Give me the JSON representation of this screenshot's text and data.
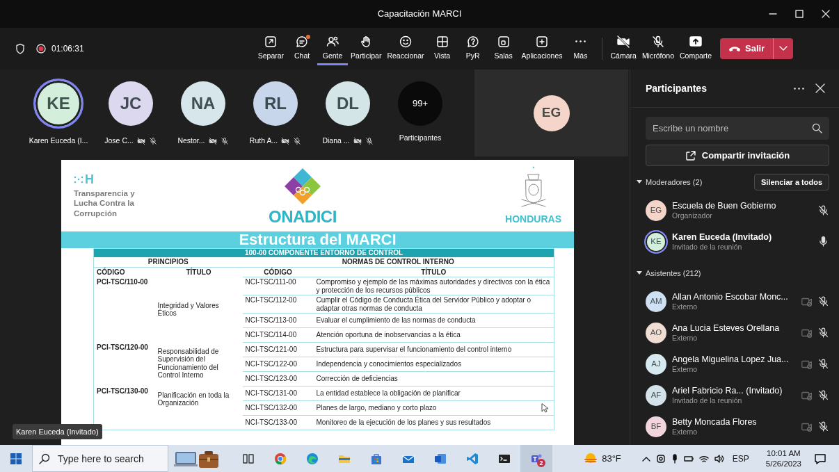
{
  "window": {
    "title": "Capacitación MARCI"
  },
  "toolbar": {
    "recording": true,
    "timer": "01:06:31",
    "buttons": [
      {
        "label": "Separar",
        "selected": false,
        "unread": false
      },
      {
        "label": "Chat",
        "selected": false,
        "unread": true
      },
      {
        "label": "Gente",
        "selected": true,
        "unread": false
      },
      {
        "label": "Participar",
        "selected": false,
        "unread": false
      },
      {
        "label": "Reaccionar",
        "selected": false,
        "unread": false
      },
      {
        "label": "Vista",
        "selected": false,
        "unread": false
      },
      {
        "label": "PyR",
        "selected": false,
        "unread": false
      },
      {
        "label": "Salas",
        "selected": false,
        "unread": false
      },
      {
        "label": "Aplicaciones",
        "selected": false,
        "unread": false
      },
      {
        "label": "Más",
        "selected": false,
        "unread": false
      }
    ],
    "devices": [
      {
        "label": "Cámara"
      },
      {
        "label": "Micrófono"
      },
      {
        "label": "Comparte"
      }
    ],
    "leave": {
      "label": "Salir"
    }
  },
  "video_strip": {
    "tiles": [
      {
        "kind": "person",
        "initials": "KE",
        "name": "Karen Euceda (I...",
        "color": "#d3eedb",
        "speaking": true,
        "muted": false,
        "camera_off": false
      },
      {
        "kind": "person",
        "initials": "JC",
        "name": "Jose C...",
        "color": "#dcd8f0",
        "speaking": false,
        "muted": true,
        "camera_off": true
      },
      {
        "kind": "person",
        "initials": "NA",
        "name": "Nestor...",
        "color": "#d6e6ea",
        "speaking": false,
        "muted": true,
        "camera_off": true
      },
      {
        "kind": "person",
        "initials": "RL",
        "name": "Ruth A...",
        "color": "#c8d6eb",
        "speaking": false,
        "muted": true,
        "camera_off": true
      },
      {
        "kind": "person",
        "initials": "DL",
        "name": "Diana ...",
        "color": "#d4e5e8",
        "speaking": false,
        "muted": true,
        "camera_off": true
      },
      {
        "kind": "overflow",
        "initials": "99+",
        "name": "Participantes",
        "color": "#0a0a0a"
      }
    ],
    "spotlight": {
      "initials": "EG",
      "color": "#f5d4c9"
    }
  },
  "slide": {
    "left_logo": {
      "mark": "H",
      "text": "Transparencia y Lucha Contra la Corrupción"
    },
    "center_logo": "ONADICI",
    "right_logo": "HONDURAS",
    "title": "Estructura del MARCI",
    "component": "100-00 COMPONENTE ENTORNO DE CONTROL",
    "group_headers": [
      "PRINCIPIOS",
      "NORMAS DE CONTROL INTERNO"
    ],
    "columns": [
      "CÓDIGO",
      "TÍTULO",
      "CÓDIGO",
      "TÍTULO"
    ],
    "groups": [
      {
        "code": "PCI-TSC/110-00",
        "title": "Integridad y Valores Éticos",
        "norms": [
          {
            "code": "NCI-TSC/111-00",
            "title": "Compromiso y ejemplo de las máximas autoridades y directivos con la ética y protección de los recursos públicos"
          },
          {
            "code": "NCI-TSC/112-00",
            "title": "Cumplir el Código de Conducta Ética del Servidor Público y adoptar o adaptar otras normas de conducta"
          },
          {
            "code": "NCI-TSC/113-00",
            "title": "Evaluar el cumplimiento de las normas de conducta"
          },
          {
            "code": "NCI-TSC/114-00",
            "title": "Atención oportuna de inobservancias a la ética"
          }
        ]
      },
      {
        "code": "PCI-TSC/120-00",
        "title": "Responsabilidad de Supervisión del Funcionamiento del Control Interno",
        "norms": [
          {
            "code": "NCI-TSC/121-00",
            "title": "Estructura para supervisar el funcionamiento del control interno"
          },
          {
            "code": "NCI-TSC/122-00",
            "title": "Independencia y conocimientos especializados"
          },
          {
            "code": "NCI-TSC/123-00",
            "title": "Corrección de deficiencias"
          }
        ]
      },
      {
        "code": "PCI-TSC/130-00",
        "title": "Planificación en toda la Organización",
        "norms": [
          {
            "code": "NCI-TSC/131-00",
            "title": "La entidad establece la obligación de planificar"
          },
          {
            "code": "NCI-TSC/132-00",
            "title": "Planes de largo, mediano y corto plazo"
          },
          {
            "code": "NCI-TSC/133-00",
            "title": "Monitoreo de la ejecución de los planes y sus resultados"
          }
        ]
      }
    ]
  },
  "name_tag": "Karen Euceda (Invitado)",
  "panel": {
    "title": "Participantes",
    "search": {
      "placeholder": "Escribe un nombre"
    },
    "share_button": "Compartir invitación",
    "sections": [
      {
        "label": "Moderadores (2)",
        "expanded": true,
        "action": "Silenciar a todos",
        "people": [
          {
            "initials": "EG",
            "color": "#f5d4c9",
            "name": "Escuela de Buen Gobierno",
            "role": "Organizador",
            "speaking": false,
            "muted": true,
            "camera_off": false
          },
          {
            "initials": "KE",
            "color": "#d3eedb",
            "name": "Karen Euceda (Invitado)",
            "role": "Invitado de la reunión",
            "speaking": true,
            "muted": false,
            "camera_off": false
          }
        ]
      },
      {
        "label": "Asistentes (212)",
        "expanded": true,
        "people": [
          {
            "initials": "AM",
            "color": "#cfe0f3",
            "name": "Allan Antonio Escobar Monc...",
            "role": "Externo",
            "speaking": false,
            "muted": true,
            "camera_off": true
          },
          {
            "initials": "AO",
            "color": "#f0ddd3",
            "name": "Ana Lucia Esteves Orellana",
            "role": "Externo",
            "speaking": false,
            "muted": true,
            "camera_off": true
          },
          {
            "initials": "AJ",
            "color": "#d6e8f0",
            "name": "Angela Miguelina Lopez Jua...",
            "role": "Externo",
            "speaking": false,
            "muted": true,
            "camera_off": true
          },
          {
            "initials": "AF",
            "color": "#d4e2e9",
            "name": "Ariel Fabricio Ra...  (Invitado)",
            "role": "Invitado de la reunión",
            "speaking": false,
            "muted": true,
            "camera_off": true
          },
          {
            "initials": "BF",
            "color": "#f2d5dc",
            "name": "Betty Moncada Flores",
            "role": "Externo",
            "speaking": false,
            "muted": true,
            "camera_off": true
          }
        ]
      }
    ]
  },
  "taskbar": {
    "search": {
      "placeholder": "Type here to search"
    },
    "apps": [
      {
        "kind": "taskview",
        "active": false
      },
      {
        "kind": "chrome",
        "active": false
      },
      {
        "kind": "edge",
        "active": false
      },
      {
        "kind": "files",
        "active": false
      },
      {
        "kind": "store",
        "active": false
      },
      {
        "kind": "mail",
        "active": false
      },
      {
        "kind": "word",
        "active": false
      },
      {
        "kind": "vscode",
        "active": false
      },
      {
        "kind": "terminal",
        "active": false
      },
      {
        "kind": "teams",
        "active": true,
        "badge": "2"
      }
    ],
    "weather": "83°F",
    "language": "ESP",
    "time": "10:01 AM",
    "date": "5/26/2023"
  }
}
